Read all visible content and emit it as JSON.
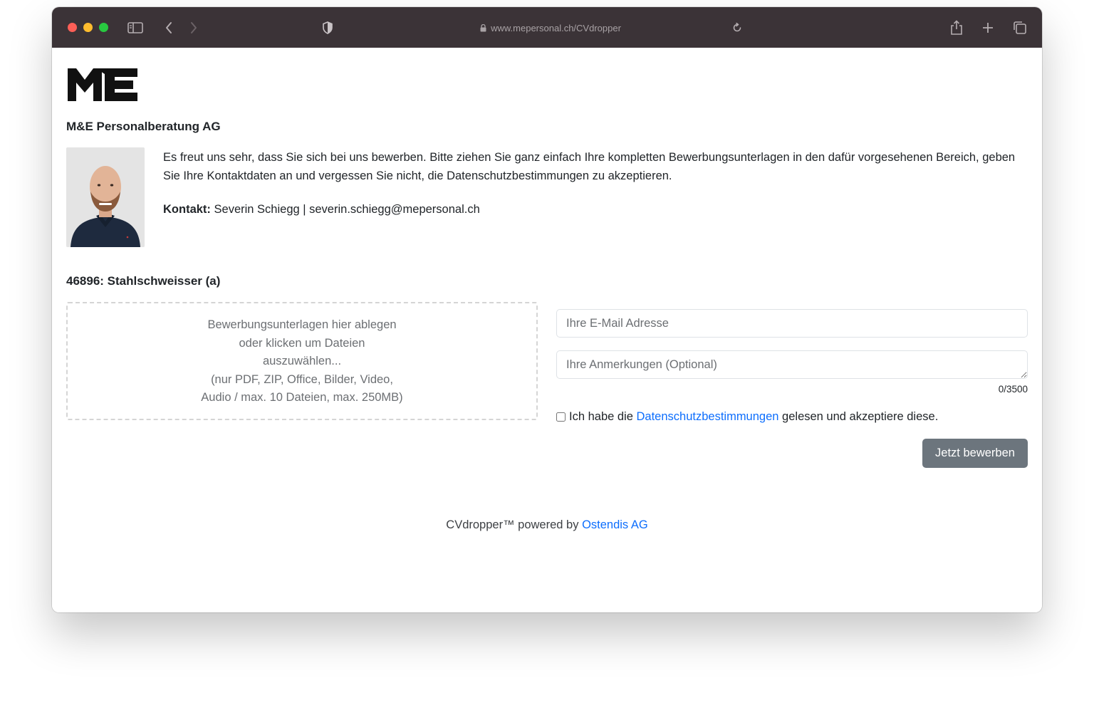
{
  "browser": {
    "url": "www.mepersonal.ch/CVdropper"
  },
  "logo": {
    "text": "ME"
  },
  "company_name": "M&E Personalberatung AG",
  "intro": {
    "text": "Es freut uns sehr, dass Sie sich bei uns bewerben. Bitte ziehen Sie ganz einfach Ihre kompletten Bewerbungsunterlagen in den dafür vorgesehenen Bereich, geben Sie Ihre Kontaktdaten an und vergessen Sie nicht, die Datenschutzbestimmungen zu akzeptieren.",
    "contact_label": "Kontakt:",
    "contact_value": "Severin Schiegg | severin.schiegg@mepersonal.ch"
  },
  "job": {
    "title": "46896: Stahlschweisser (a)"
  },
  "dropzone": {
    "line1": "Bewerbungsunterlagen hier ablegen",
    "line2": "oder klicken um Dateien",
    "line3": "auszuwählen...",
    "line4": "(nur PDF, ZIP, Office, Bilder, Video,",
    "line5": "Audio / max. 10 Dateien, max. 250MB)"
  },
  "form": {
    "email_placeholder": "Ihre E-Mail Adresse",
    "email_value": "",
    "remarks_placeholder": "Ihre Anmerkungen (Optional)",
    "remarks_value": "",
    "char_counter": "0/3500",
    "consent_prefix": "Ich habe die",
    "consent_link": "Datenschutzbestimmungen",
    "consent_suffix": "gelesen und akzeptiere diese.",
    "consent_checked": false,
    "submit_label": "Jetzt bewerben"
  },
  "footer": {
    "text": "CVdropper™ powered by",
    "link": "Ostendis AG"
  },
  "colors": {
    "toolbar": "#3b3337",
    "link": "#0d6efd",
    "button": "#6c757d"
  }
}
